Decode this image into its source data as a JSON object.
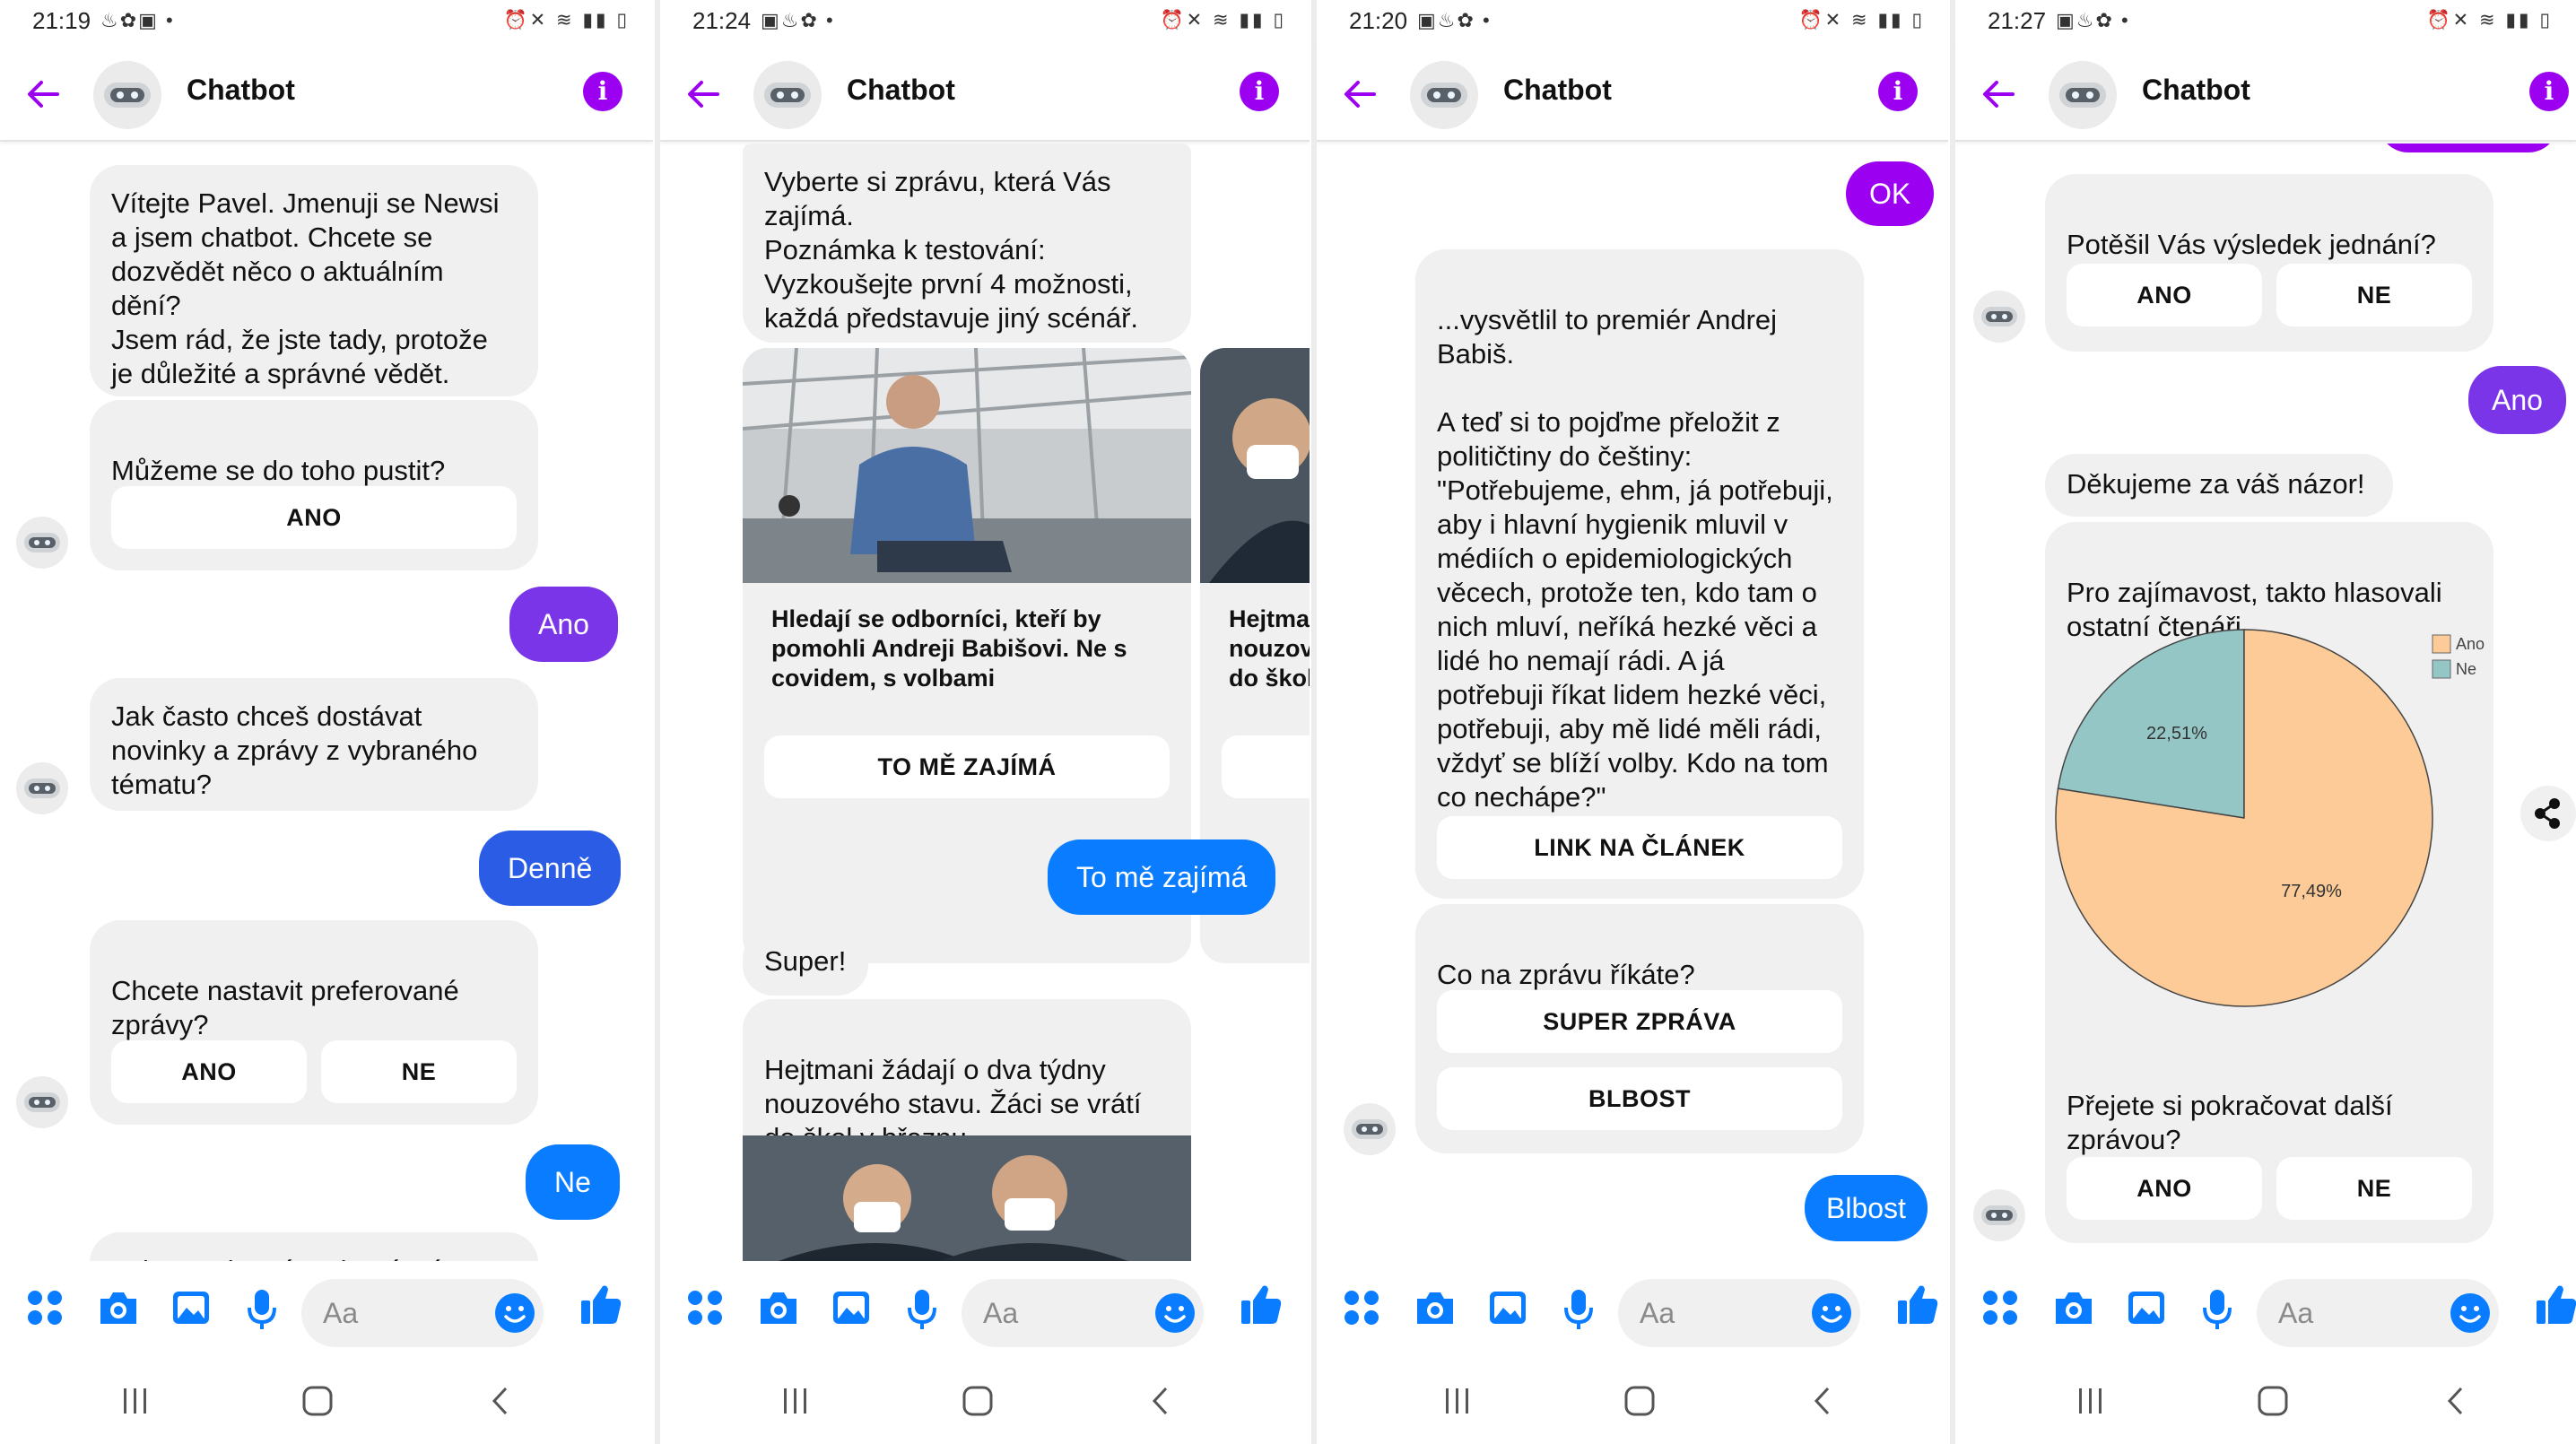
{
  "colors": {
    "accent": "#9b00f0",
    "user_bubble_purple": "#7b35e8",
    "user_bubble_blue": "#2b5ce6",
    "messenger_blue": "#0a7cff",
    "pie_ano": "#fdcb98",
    "pie_ne": "#94c6c6"
  },
  "icons": [
    "arrow-left-icon",
    "bot-icon",
    "info-icon",
    "apps-icon",
    "camera-icon",
    "image-icon",
    "microphone-icon",
    "emoji-icon",
    "thumbs-up-icon",
    "menu-nav-icon",
    "home-nav-icon",
    "back-nav-icon",
    "share-icon"
  ],
  "screens": [
    {
      "time": "21:19",
      "title": "Chatbot",
      "input_placeholder": "Aa",
      "messages": {
        "welcome": "Vítejte Pavel. Jmenuji se Newsi\na jsem chatbot. Chcete se\ndozvědět něco o aktuálním\ndění?\nJsem rád, že jste tady, protože\nje důležité a správné vědět.",
        "q1": "Můžeme se do toho pustit?",
        "q1_btn": "ANO",
        "a1": "Ano",
        "q2": "Jak často chceš dostávat\nnovinky a zprávy z vybraného\ntématu?",
        "a2": "Denně",
        "q3": "Chcete nastavit preferované\nzprávy?",
        "q3_btn_yes": "ANO",
        "q3_btn_no": "NE",
        "a3": "Ne",
        "cut": "Vyberte si zprávu, která Vás"
      }
    },
    {
      "time": "21:24",
      "title": "Chatbot",
      "input_placeholder": "Aa",
      "messages": {
        "intro": "Vyberte si zprávu, která Vás\nzajímá.\nPoznámka k testování:\nVyzkoušejte první 4 možnosti,\nkaždá představuje jiný scénář.",
        "card1_title": "Hledají se odborníci, kteří by\npomohli Andreji Babišovi. Ne s\ncovidem, s volbami",
        "card1_btn": "TO MĚ ZAJÍMÁ",
        "card2_title": "Hejtmani žádají o dva týdny\nnouzového stavu. Žáci se vrátí\ndo škol v březnu",
        "a1": "To mě zajímá",
        "r1": "Super!",
        "r2": "Hejtmani žádají o dva týdny\nnouzového stavu. Žáci se vrátí\ndo škol v březnu"
      }
    },
    {
      "time": "21:20",
      "title": "Chatbot",
      "input_placeholder": "Aa",
      "messages": {
        "a0": "OK",
        "article": "...vysvětlil to premiér Andrej\nBabiš.\n\nA teď si to pojďme přeložit z\npolitičtiny do češtiny:\n\"Potřebujeme, ehm, já potřebuji,\naby i hlavní hygienik mluvil v\nmédiích o epidemiologických\nvěcech, protože ten, kdo tam o\nnich mluví, neříká hezké věci a\nlidé ho nemají rádi. A já\npotřebuji říkat lidem hezké věci,\npotřebuji, aby mě lidé měli rádi,\nvždyť se blíží volby. Kdo na tom\nco nechápe?\"",
        "link_btn": "LINK NA ČLÁNEK",
        "q": "Co na zprávu říkáte?",
        "btn1": "SUPER ZPRÁVA",
        "btn2": "BLBOST",
        "a1": "Blbost"
      }
    },
    {
      "time": "21:27",
      "title": "Chatbot",
      "input_placeholder": "Aa",
      "messages": {
        "q1": "Potěšil Vás výsledek jednání?",
        "q1_yes": "ANO",
        "q1_no": "NE",
        "a1": "Ano",
        "thanks": "Děkujeme za váš názor!",
        "info": "Pro zajímavost, takto hlasovali\nostatní čtenáři",
        "q2": "Přejete si pokračovat další\nzprávou?",
        "q2_yes": "ANO",
        "q2_no": "NE"
      }
    }
  ],
  "chart_data": {
    "type": "pie",
    "categories": [
      "Ano",
      "Ne"
    ],
    "values": [
      77.49,
      22.51
    ],
    "labels": [
      "77,49%",
      "22,51%"
    ],
    "legend": [
      "Ano",
      "Ne"
    ],
    "legend_position": "top-right",
    "colors": [
      "#fdcb98",
      "#94c6c6"
    ]
  }
}
